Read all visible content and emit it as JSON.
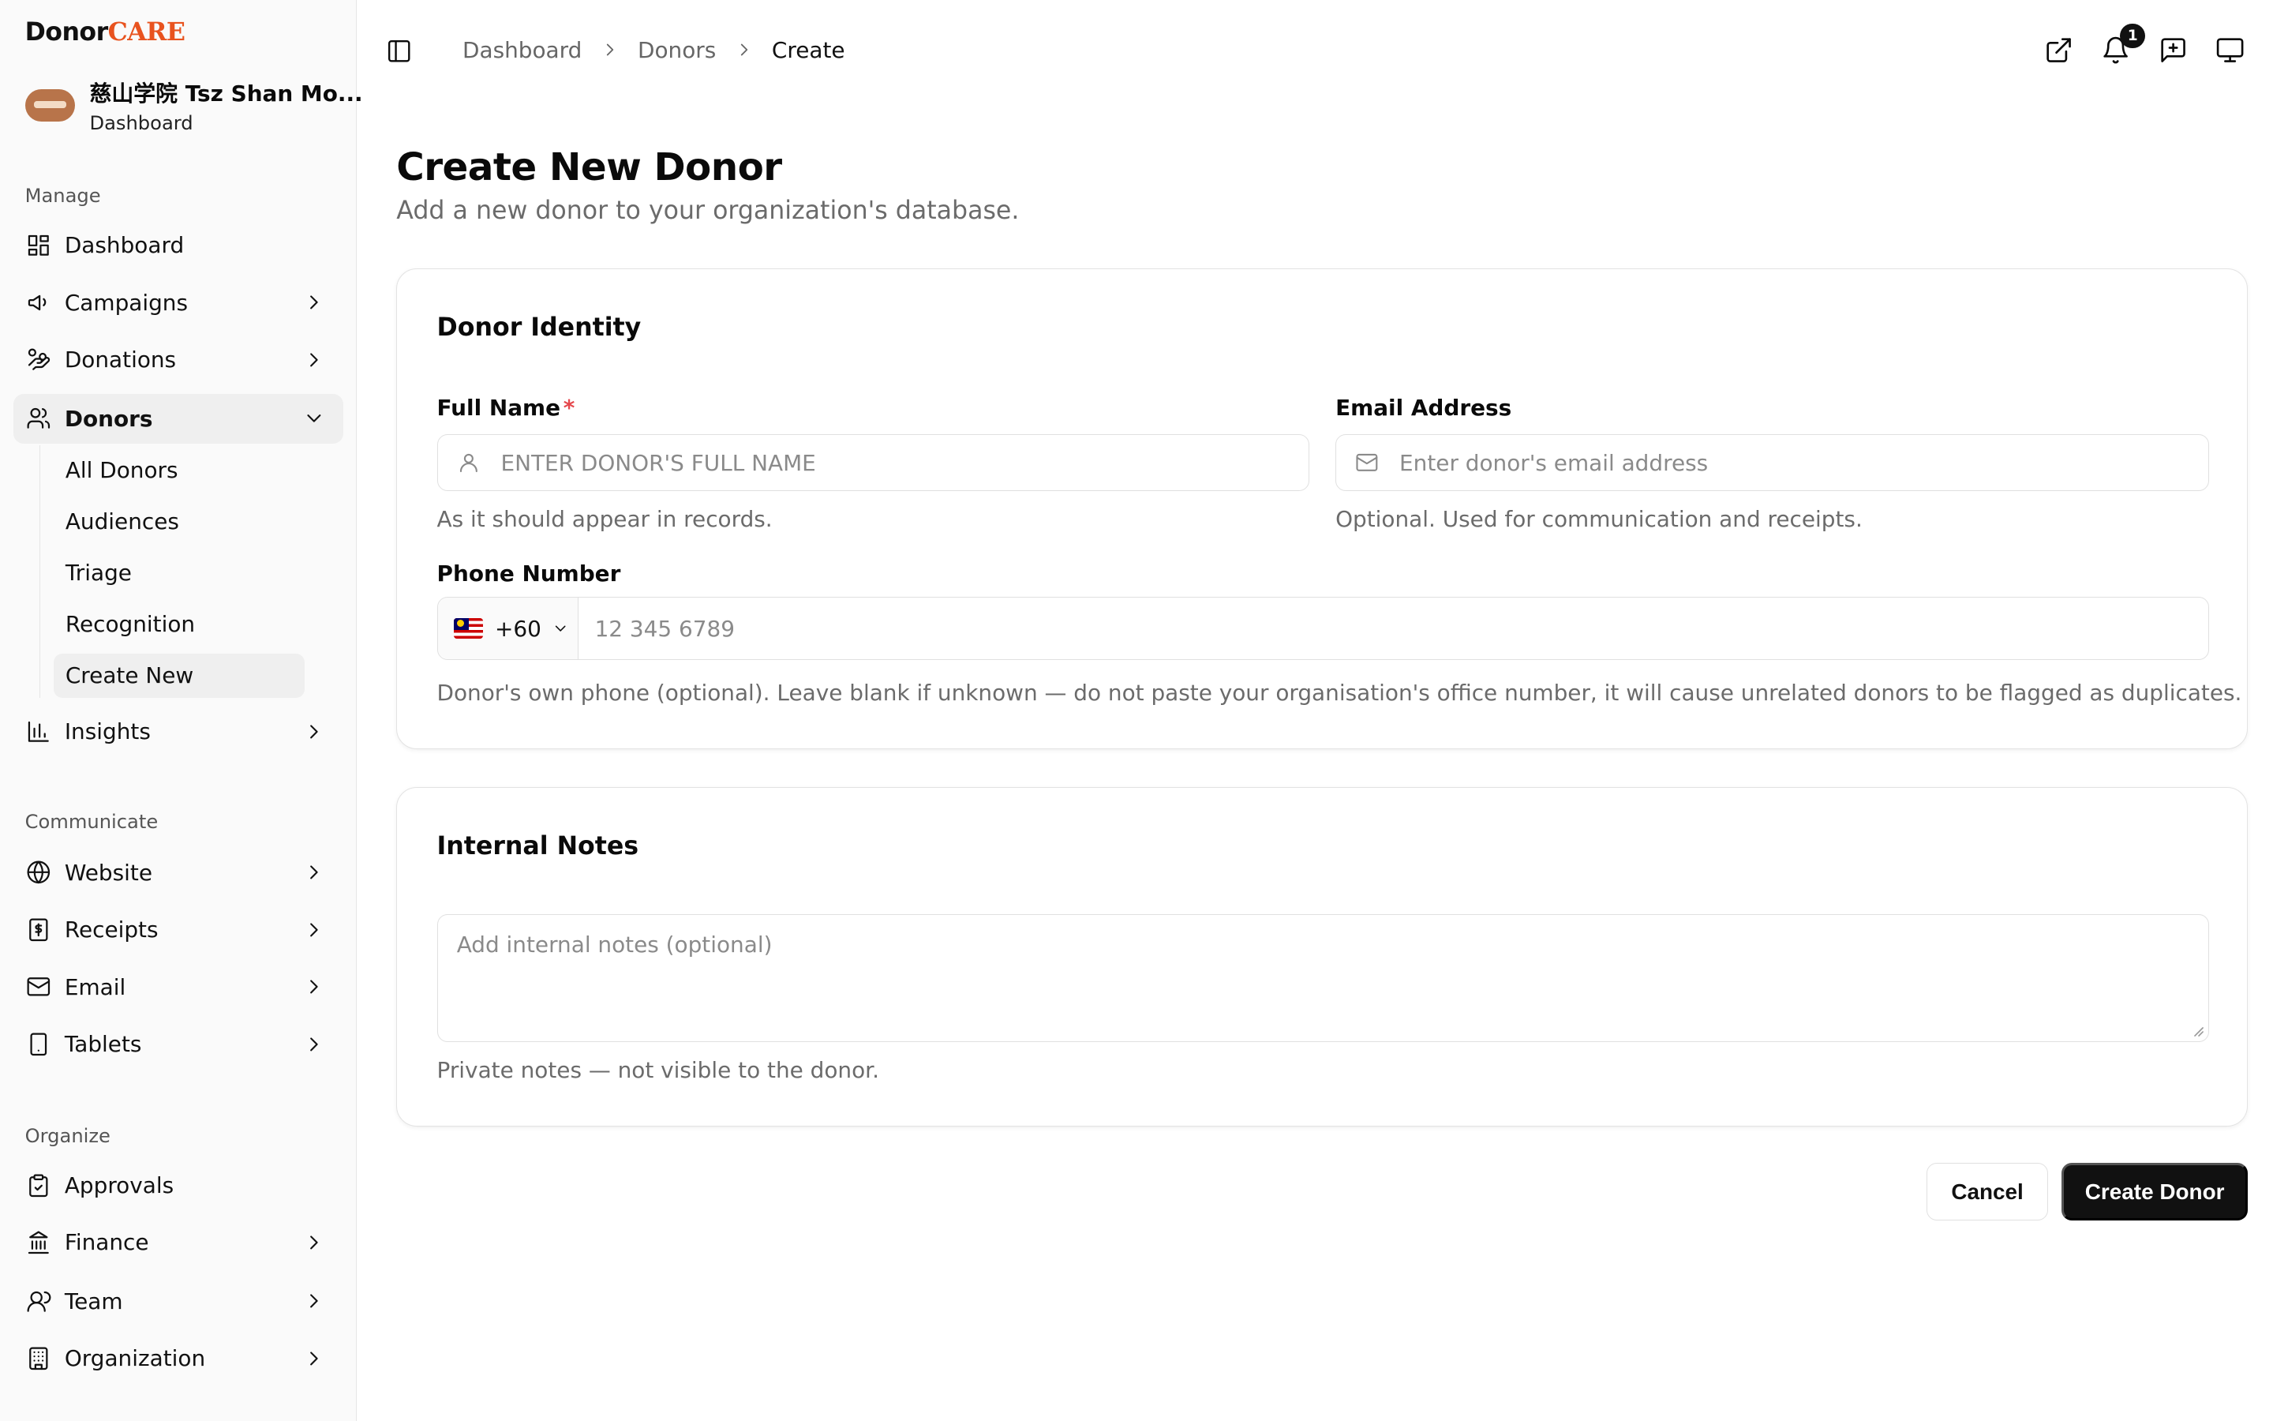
{
  "brand": {
    "part1": "Donor",
    "part2": "CARE"
  },
  "org": {
    "name": "慈山学院 Tsz Shan Mo...",
    "sub": "Dashboard"
  },
  "sidebar": {
    "manage_label": "Manage",
    "communicate_label": "Communicate",
    "organize_label": "Organize",
    "items": {
      "dashboard": "Dashboard",
      "campaigns": "Campaigns",
      "donations": "Donations",
      "donors": "Donors",
      "insights": "Insights",
      "website": "Website",
      "receipts": "Receipts",
      "email": "Email",
      "tablets": "Tablets",
      "approvals": "Approvals",
      "finance": "Finance",
      "team": "Team",
      "organization": "Organization"
    },
    "donors_sub": [
      "All Donors",
      "Audiences",
      "Triage",
      "Recognition",
      "Create New"
    ]
  },
  "breadcrumb": [
    "Dashboard",
    "Donors",
    "Create"
  ],
  "notifications_count": "1",
  "page": {
    "title": "Create New Donor",
    "subtitle": "Add a new donor to your organization's database."
  },
  "identity": {
    "title": "Donor Identity",
    "full_name": {
      "label": "Full Name",
      "required": "*",
      "placeholder": "ENTER DONOR'S FULL NAME",
      "help": "As it should appear in records."
    },
    "email": {
      "label": "Email Address",
      "placeholder": "Enter donor's email address",
      "help": "Optional. Used for communication and receipts."
    },
    "phone": {
      "label": "Phone Number",
      "country_code": "+60",
      "placeholder": "12 345 6789",
      "help": "Donor's own phone (optional). Leave blank if unknown — do not paste your organisation's office number, it will cause unrelated donors to be flagged as duplicates."
    }
  },
  "notes": {
    "title": "Internal Notes",
    "placeholder": "Add internal notes (optional)",
    "help": "Private notes — not visible to the donor."
  },
  "actions": {
    "cancel": "Cancel",
    "create": "Create Donor"
  },
  "colors": {
    "brand_accent": "#e8531f",
    "primary_button": "#111111",
    "required": "#e5484d"
  }
}
